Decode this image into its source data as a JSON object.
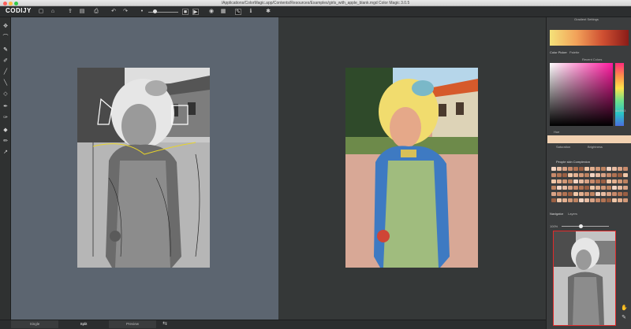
{
  "window": {
    "title": "/Applications/ColorMagic.app/Contents/Resources/Examples/girls_with_apple_blank.mgd Color Magic 3.0.5"
  },
  "toolbar": {
    "logo": "CODIJY",
    "icons": [
      "folder-icon",
      "save-icon",
      "export-icon",
      "undo-icon",
      "redo-icon",
      "brush-size-icon",
      "slider-icon",
      "stop-icon",
      "play-icon",
      "eye-icon",
      "settings-icon",
      "pen-icon",
      "help-icon",
      "gear-icon"
    ]
  },
  "right_panel": {
    "gradient_title": "Gradient Settings",
    "color_picker_tab": "Color Picker",
    "color_picker_tab2": "Palette",
    "recent_title": "Recent Colors",
    "hex_value": "dad9b3",
    "people_title": "People skin Complexion",
    "navigator_tab": "Navigator",
    "navigator_tab2": "Layers",
    "zoom_value": "100%",
    "labels": [
      "Hue",
      "Saturation",
      "Brightness",
      "Lightness",
      "Undo"
    ]
  },
  "bottom_tabs": [
    "Single",
    "Split",
    "Preview"
  ],
  "colors": {
    "accent_selected": "#f2d2b2",
    "navigator_border": "#e12a2a",
    "edit_bg": "#5c6570",
    "preview_bg": "#353838"
  }
}
